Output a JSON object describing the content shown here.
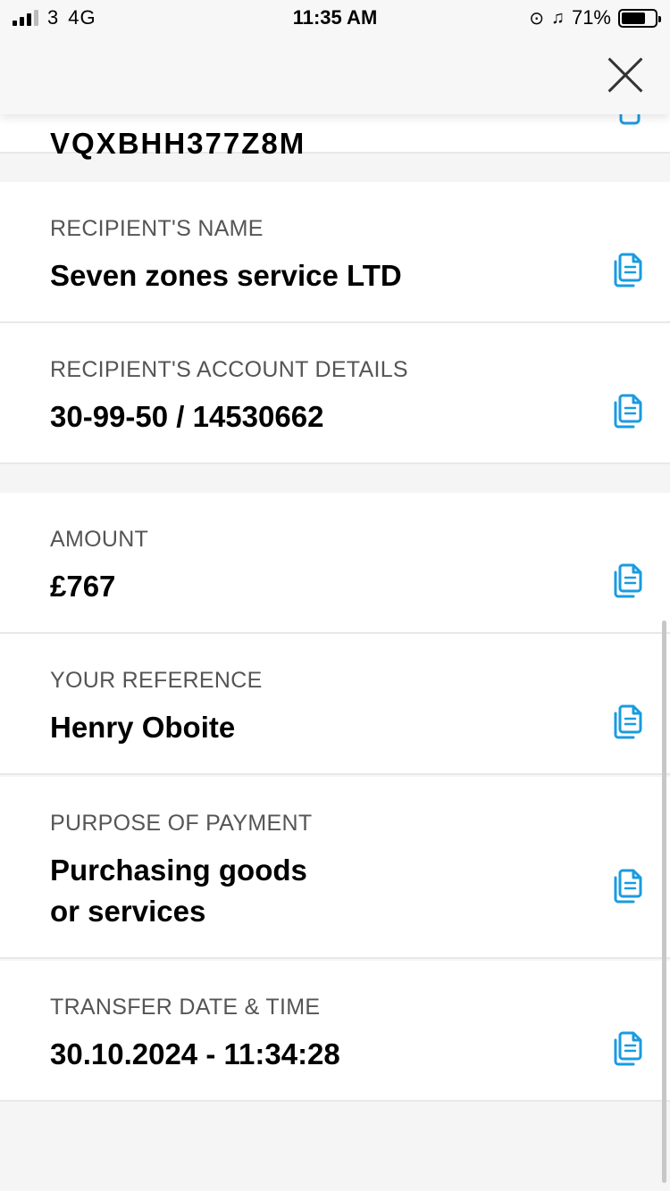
{
  "status": {
    "carrier": "3",
    "network": "4G",
    "time": "11:35 AM",
    "battery": "71%",
    "battery_level": 0.71
  },
  "partial_top_value": "VQXBHH377Z8M",
  "sections": [
    {
      "label": "RECIPIENT'S NAME",
      "value": "Seven zones service LTD"
    },
    {
      "label": "RECIPIENT'S ACCOUNT DETAILS",
      "value": "30-99-50 / 14530662"
    },
    {
      "label": "AMOUNT",
      "value": "£767"
    },
    {
      "label": "YOUR REFERENCE",
      "value": "Henry Oboite"
    },
    {
      "label": "PURPOSE OF PAYMENT",
      "value_line1": "Purchasing goods",
      "value_line2": "or services"
    },
    {
      "label": "TRANSFER DATE & TIME",
      "value": "30.10.2024 - 11:34:28"
    }
  ],
  "colors": {
    "accent": "#1a9be0",
    "background": "#f5f5f5",
    "card": "#ffffff",
    "label": "#555555"
  },
  "icons": {
    "close": "close-icon",
    "copy": "copy-icon"
  }
}
